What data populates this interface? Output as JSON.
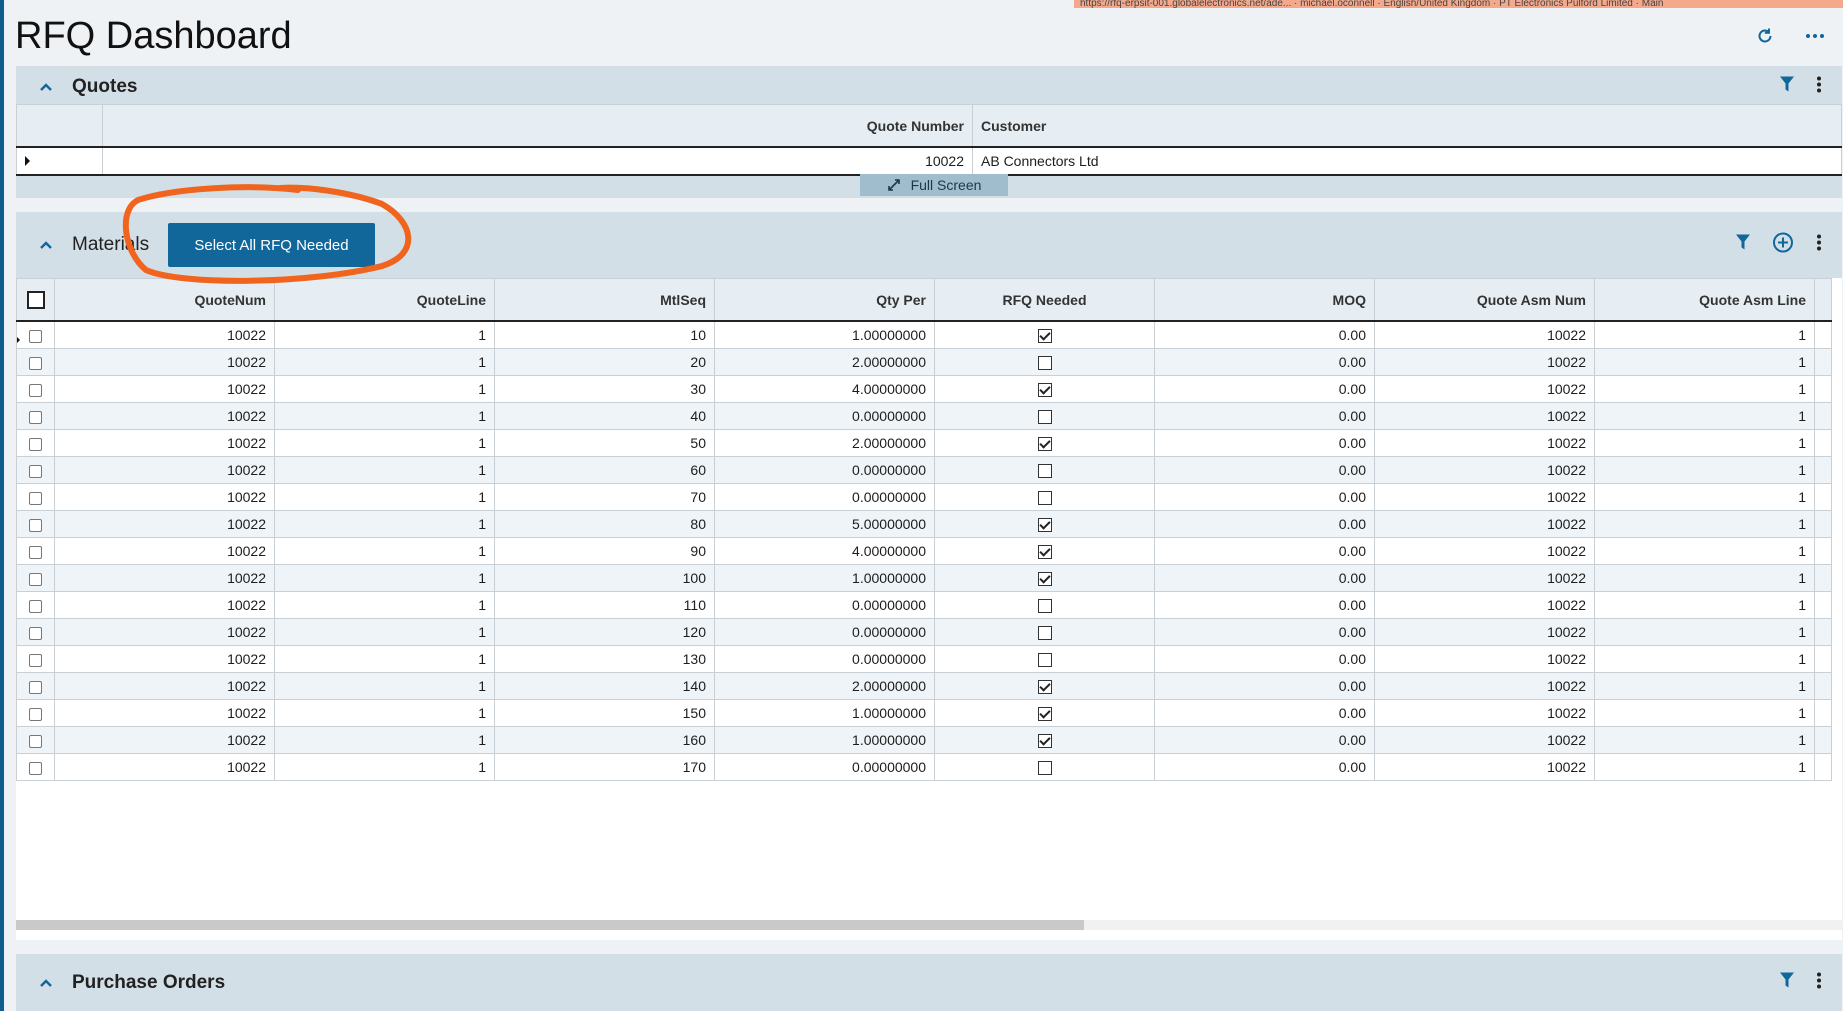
{
  "browser": {
    "url_bar_text": "https://rfq-erpsit-001.globalelectronics.net/ade... · michael.oconnell · English/United Kingdom · PT Electronics Pulford Limited · Main"
  },
  "page": {
    "title": "RFQ Dashboard",
    "refresh_icon": "refresh-icon",
    "more_icon": "ellipsis-icon"
  },
  "quotes": {
    "title": "Quotes",
    "columns": [
      "",
      "Quote Number",
      "Customer"
    ],
    "rows": [
      {
        "quote_number": "10022",
        "customer": "AB Connectors Ltd"
      }
    ],
    "fullscreen_label": "Full Screen"
  },
  "materials": {
    "title": "Materials",
    "select_button": "Select All RFQ Needed",
    "columns": [
      "QuoteNum",
      "QuoteLine",
      "MtlSeq",
      "Qty Per",
      "RFQ Needed",
      "MOQ",
      "Quote Asm Num",
      "Quote Asm Line"
    ],
    "rows": [
      {
        "quotenum": "10022",
        "quoteline": "1",
        "mtlseq": "10",
        "qtyper": "1.00000000",
        "rfq": true,
        "moq": "0.00",
        "asmnum": "10022",
        "asmline": "1"
      },
      {
        "quotenum": "10022",
        "quoteline": "1",
        "mtlseq": "20",
        "qtyper": "2.00000000",
        "rfq": false,
        "moq": "0.00",
        "asmnum": "10022",
        "asmline": "1"
      },
      {
        "quotenum": "10022",
        "quoteline": "1",
        "mtlseq": "30",
        "qtyper": "4.00000000",
        "rfq": true,
        "moq": "0.00",
        "asmnum": "10022",
        "asmline": "1"
      },
      {
        "quotenum": "10022",
        "quoteline": "1",
        "mtlseq": "40",
        "qtyper": "0.00000000",
        "rfq": false,
        "moq": "0.00",
        "asmnum": "10022",
        "asmline": "1"
      },
      {
        "quotenum": "10022",
        "quoteline": "1",
        "mtlseq": "50",
        "qtyper": "2.00000000",
        "rfq": true,
        "moq": "0.00",
        "asmnum": "10022",
        "asmline": "1"
      },
      {
        "quotenum": "10022",
        "quoteline": "1",
        "mtlseq": "60",
        "qtyper": "0.00000000",
        "rfq": false,
        "moq": "0.00",
        "asmnum": "10022",
        "asmline": "1"
      },
      {
        "quotenum": "10022",
        "quoteline": "1",
        "mtlseq": "70",
        "qtyper": "0.00000000",
        "rfq": false,
        "moq": "0.00",
        "asmnum": "10022",
        "asmline": "1"
      },
      {
        "quotenum": "10022",
        "quoteline": "1",
        "mtlseq": "80",
        "qtyper": "5.00000000",
        "rfq": true,
        "moq": "0.00",
        "asmnum": "10022",
        "asmline": "1"
      },
      {
        "quotenum": "10022",
        "quoteline": "1",
        "mtlseq": "90",
        "qtyper": "4.00000000",
        "rfq": true,
        "moq": "0.00",
        "asmnum": "10022",
        "asmline": "1"
      },
      {
        "quotenum": "10022",
        "quoteline": "1",
        "mtlseq": "100",
        "qtyper": "1.00000000",
        "rfq": true,
        "moq": "0.00",
        "asmnum": "10022",
        "asmline": "1"
      },
      {
        "quotenum": "10022",
        "quoteline": "1",
        "mtlseq": "110",
        "qtyper": "0.00000000",
        "rfq": false,
        "moq": "0.00",
        "asmnum": "10022",
        "asmline": "1"
      },
      {
        "quotenum": "10022",
        "quoteline": "1",
        "mtlseq": "120",
        "qtyper": "0.00000000",
        "rfq": false,
        "moq": "0.00",
        "asmnum": "10022",
        "asmline": "1"
      },
      {
        "quotenum": "10022",
        "quoteline": "1",
        "mtlseq": "130",
        "qtyper": "0.00000000",
        "rfq": false,
        "moq": "0.00",
        "asmnum": "10022",
        "asmline": "1"
      },
      {
        "quotenum": "10022",
        "quoteline": "1",
        "mtlseq": "140",
        "qtyper": "2.00000000",
        "rfq": true,
        "moq": "0.00",
        "asmnum": "10022",
        "asmline": "1"
      },
      {
        "quotenum": "10022",
        "quoteline": "1",
        "mtlseq": "150",
        "qtyper": "1.00000000",
        "rfq": true,
        "moq": "0.00",
        "asmnum": "10022",
        "asmline": "1"
      },
      {
        "quotenum": "10022",
        "quoteline": "1",
        "mtlseq": "160",
        "qtyper": "1.00000000",
        "rfq": true,
        "moq": "0.00",
        "asmnum": "10022",
        "asmline": "1"
      },
      {
        "quotenum": "10022",
        "quoteline": "1",
        "mtlseq": "170",
        "qtyper": "0.00000000",
        "rfq": false,
        "moq": "0.00",
        "asmnum": "10022",
        "asmline": "1"
      }
    ]
  },
  "purchase_orders": {
    "title": "Purchase Orders"
  },
  "colors": {
    "accent": "#11669a",
    "panel": "#d3dfe6",
    "annotation": "#f0641e"
  }
}
